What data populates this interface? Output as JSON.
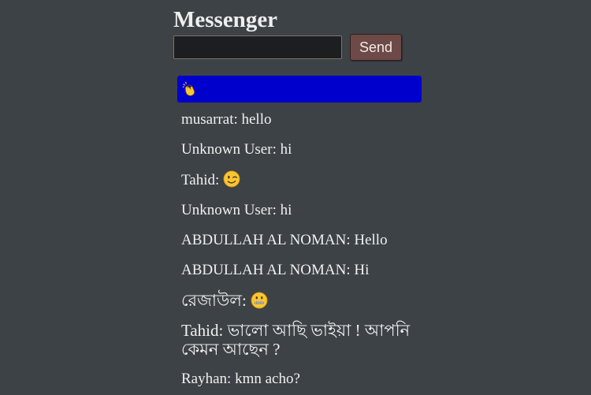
{
  "app": {
    "title": "Messenger",
    "input_value": "",
    "send_label": "Send"
  },
  "highlight": {
    "emoji": "clapping-hands-emoji"
  },
  "messages": [
    {
      "text": "musarrat: hello"
    },
    {
      "text": "Unknown User: hi"
    },
    {
      "text": "Tahid: ",
      "emoji": "winking-face-emoji"
    },
    {
      "text": "Unknown User: hi"
    },
    {
      "text": "ABDULLAH AL NOMAN: Hello"
    },
    {
      "text": "ABDULLAH AL NOMAN: Hi"
    },
    {
      "text": "রেজাউল: ",
      "emoji": "zipper-mouth-face-emoji"
    },
    {
      "text": "Tahid: ভালো আছি ভাইয়া ! আপনি কেমন আছেন ?"
    },
    {
      "text": "Rayhan: kmn acho?"
    }
  ],
  "colors": {
    "background": "#3d4246",
    "highlight": "#0000cd",
    "send_button": "#6d4a47",
    "emoji_yellow": "#f8c534"
  }
}
